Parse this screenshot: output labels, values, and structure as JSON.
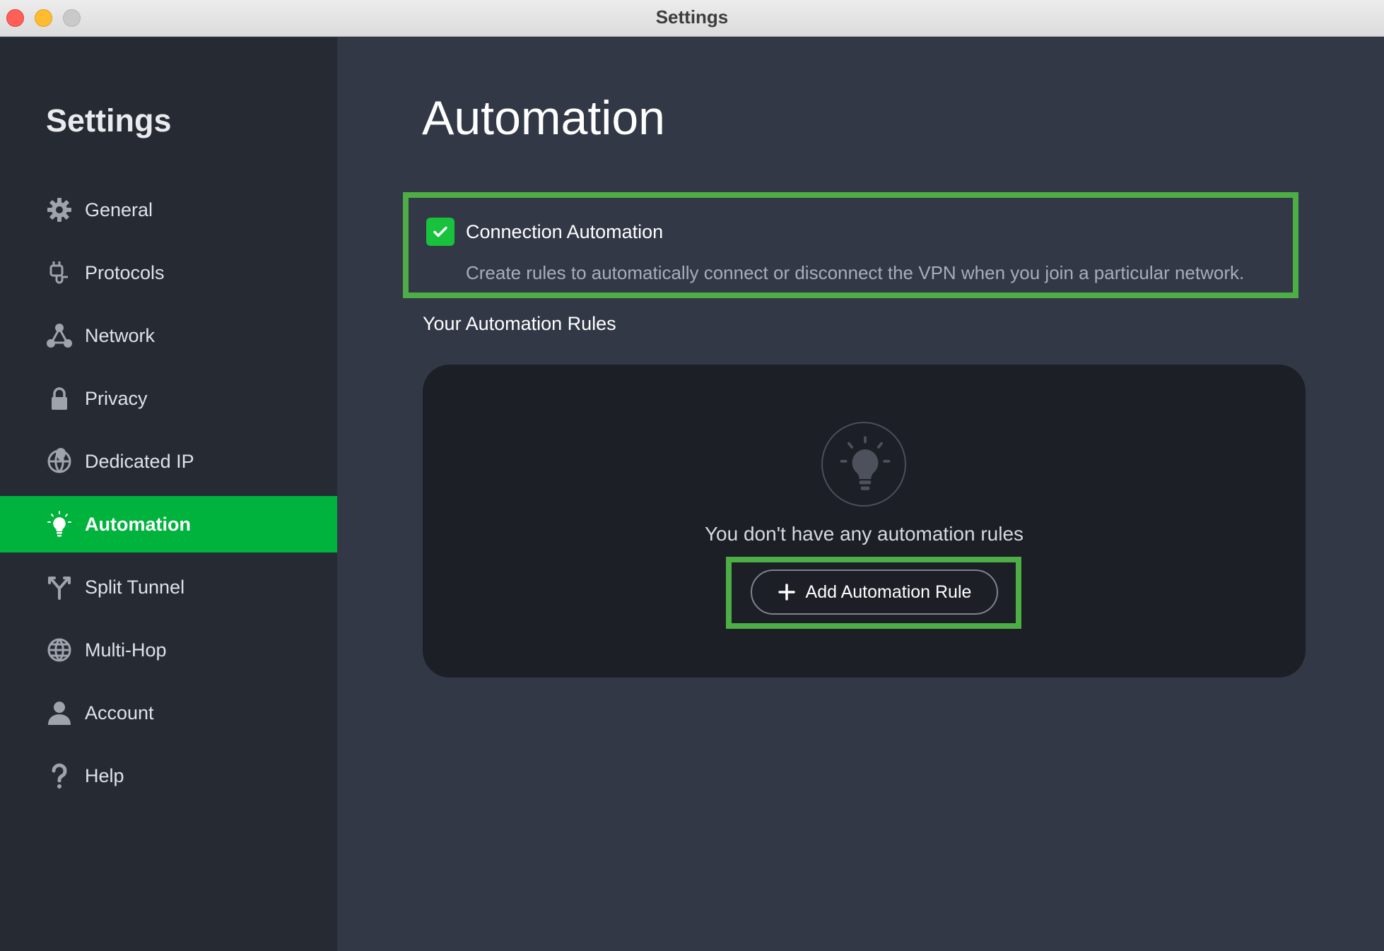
{
  "window": {
    "title": "Settings"
  },
  "sidebar": {
    "title": "Settings",
    "items": [
      {
        "label": "General",
        "icon": "gear-icon"
      },
      {
        "label": "Protocols",
        "icon": "plug-icon"
      },
      {
        "label": "Network",
        "icon": "network-icon"
      },
      {
        "label": "Privacy",
        "icon": "lock-icon"
      },
      {
        "label": "Dedicated IP",
        "icon": "globe-pin-icon"
      },
      {
        "label": "Automation",
        "icon": "lightbulb-icon",
        "active": true
      },
      {
        "label": "Split Tunnel",
        "icon": "split-icon"
      },
      {
        "label": "Multi-Hop",
        "icon": "globe-icon"
      },
      {
        "label": "Account",
        "icon": "user-icon"
      },
      {
        "label": "Help",
        "icon": "question-icon"
      }
    ]
  },
  "main": {
    "title": "Automation",
    "connection_automation": {
      "label": "Connection Automation",
      "checked": true,
      "description": "Create rules to automatically connect or disconnect the VPN when you join a particular network."
    },
    "rules_heading": "Your Automation Rules",
    "empty_state": {
      "icon": "lightbulb-icon",
      "text": "You don't have any automation rules"
    },
    "add_button": {
      "label": "Add Automation Rule",
      "icon": "plus-icon"
    }
  },
  "colors": {
    "accent": "#00b33d",
    "highlight": "#4cae45",
    "sidebar_bg": "#262a33",
    "main_bg": "#323846",
    "panel_bg": "#1c1f26"
  }
}
